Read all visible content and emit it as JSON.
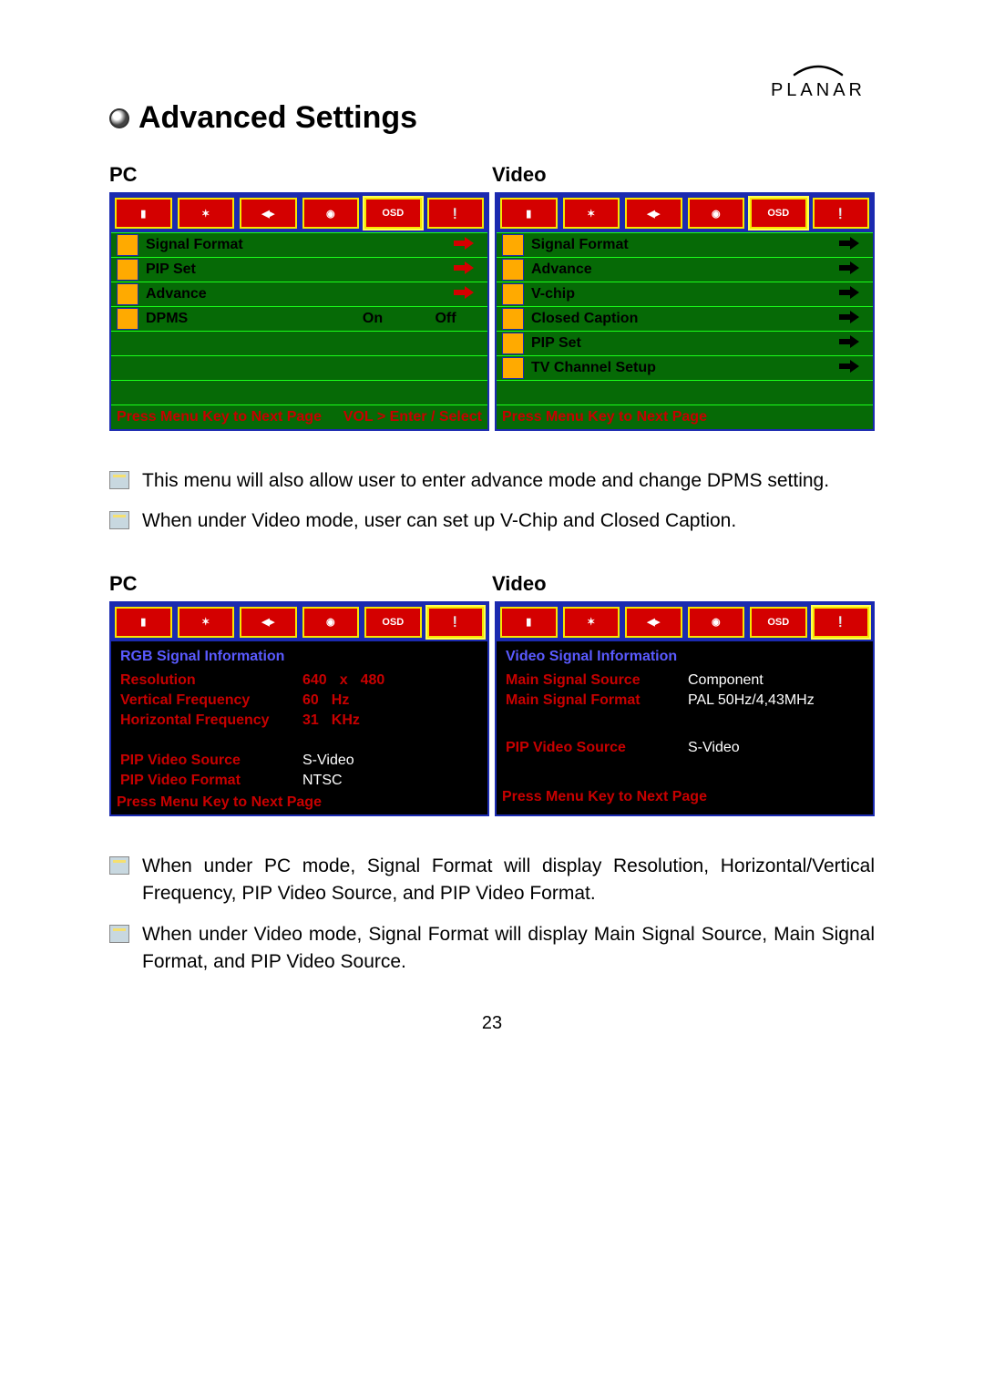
{
  "brand": "PLANAR",
  "page_title": "Advanced Settings",
  "page_number": "23",
  "section1": {
    "pc_heading": "PC",
    "video_heading": "Video",
    "pc_menu": {
      "tabs": [
        "",
        "",
        "",
        "",
        "OSD",
        ""
      ],
      "rows": [
        {
          "label": "Signal Format",
          "arrow": true
        },
        {
          "label": "PIP Set",
          "arrow": true
        },
        {
          "label": "Advance",
          "arrow": true
        },
        {
          "label": "DPMS",
          "val_on": "On",
          "val_off": "Off"
        }
      ],
      "footer_left": "Press Menu Key to Next Page",
      "footer_right": "VOL > Enter / Select"
    },
    "video_menu": {
      "tabs": [
        "",
        "",
        "",
        "",
        "OSD",
        ""
      ],
      "rows": [
        {
          "label": "Signal Format"
        },
        {
          "label": "Advance"
        },
        {
          "label": "V-chip"
        },
        {
          "label": "Closed Caption"
        },
        {
          "label": "PIP Set"
        },
        {
          "label": "TV Channel Setup"
        }
      ],
      "footer_left": "Press Menu Key to Next Page"
    }
  },
  "notes1": [
    "This menu will also allow user to enter advance mode and change DPMS setting.",
    "When under Video mode, user can set up V-Chip and Closed Caption."
  ],
  "section2": {
    "pc_heading": "PC",
    "video_heading": "Video",
    "pc_info": {
      "title": "RGB Signal Information",
      "rows": [
        {
          "k": "Resolution",
          "v": [
            "640",
            "x",
            "480"
          ]
        },
        {
          "k": "Vertical Frequency",
          "v": [
            "60",
            "Hz"
          ]
        },
        {
          "k": "Horizontal Frequency",
          "v": [
            "31",
            "KHz"
          ]
        }
      ],
      "rows2": [
        {
          "k": "PIP Video Source",
          "v": "S-Video"
        },
        {
          "k": "PIP Video Format",
          "v": "NTSC"
        }
      ],
      "footer_left": "Press Menu Key to Next Page"
    },
    "video_info": {
      "title": "Video Signal Information",
      "rows": [
        {
          "k": "Main Signal Source",
          "v": "Component"
        },
        {
          "k": "Main Signal Format",
          "v": "PAL 50Hz/4,43MHz"
        }
      ],
      "rows2": [
        {
          "k": "PIP Video Source",
          "v": "S-Video"
        }
      ],
      "footer_left": "Press Menu Key to Next Page"
    }
  },
  "notes2": [
    "When under PC mode, Signal Format will display Resolution, Horizontal/Vertical Frequency, PIP Video Source, and PIP Video Format.",
    "When under Video mode, Signal Format will display Main Signal Source, Main Signal Format, and PIP Video Source."
  ]
}
